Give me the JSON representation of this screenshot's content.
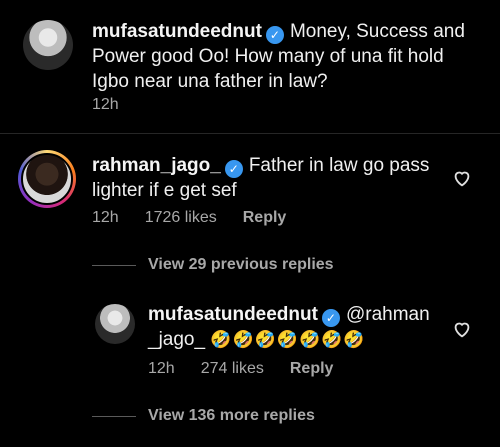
{
  "comment": {
    "username": "mufasatundeednut",
    "text": "Money, Success and Power good Oo! How many of una fit hold Igbo near una father in law?",
    "time": "12h"
  },
  "reply1": {
    "username": "rahman_jago_",
    "text": "Father in law go pass lighter if e get sef",
    "time": "12h",
    "likes": "1726 likes",
    "reply_label": "Reply"
  },
  "view_previous": "View 29 previous replies",
  "reply2": {
    "username": "mufasatundeednut",
    "mention_a": "@rahman",
    "mention_b": "_jago_",
    "emojis": "🤣🤣🤣🤣🤣🤣🤣",
    "time": "12h",
    "likes": "274 likes",
    "reply_label": "Reply"
  },
  "view_more": "View 136 more replies",
  "icons": {
    "verified": "verified-badge-icon",
    "heart": "heart-outline-icon"
  },
  "colors": {
    "verified": "#3897f0",
    "background": "#000000",
    "secondary_text": "#a8a8a8"
  }
}
